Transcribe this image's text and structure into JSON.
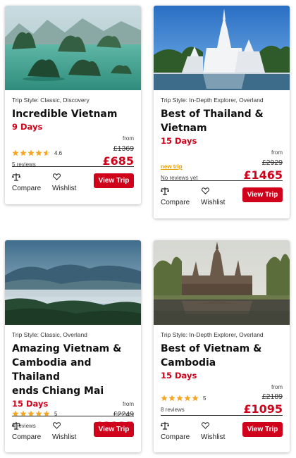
{
  "colors": {
    "accent": "#d0021b",
    "star": "#f5a623",
    "new_trip": "#e8a300"
  },
  "cards": [
    {
      "image": "halong-bay-limestone-islands",
      "trip_style": "Trip Style: Classic, Discovery",
      "title_lines": [
        "Incredible Vietnam"
      ],
      "days": "9 Days",
      "rating": 4.6,
      "rating_text": "4.6",
      "reviews": "5 reviews",
      "from": "from",
      "old_price": "£1369",
      "price": "£685",
      "compare": "Compare",
      "wishlist": "Wishlist",
      "button": "View Trip"
    },
    {
      "image": "white-temple-chiang-rai",
      "trip_style": "Trip Style: In-Depth Explorer, Overland",
      "title_lines": [
        "Best of Thailand &",
        "Vietnam"
      ],
      "days": "15 Days",
      "new_trip": "new trip",
      "reviews": "No reviews yet",
      "from": "from",
      "old_price": "£2929",
      "price": "£1465",
      "compare": "Compare",
      "wishlist": "Wishlist",
      "button": "View Trip"
    },
    {
      "image": "misty-mountain-valley",
      "trip_style": "Trip Style: Classic, Overland",
      "title_lines": [
        "Amazing Vietnam &",
        "Cambodia and Thailand",
        "ends Chiang Mai"
      ],
      "days": "15 Days",
      "rating": 5,
      "rating_text": "5",
      "reviews": "4 reviews",
      "from": "from",
      "old_price": "£2249",
      "price": "£1125",
      "compare": "Compare",
      "wishlist": "Wishlist",
      "button": "View Trip"
    },
    {
      "image": "angkor-wat-reflection",
      "trip_style": "Trip Style: In-Depth Explorer, Overland",
      "title_lines": [
        "Best of Vietnam &",
        "Cambodia"
      ],
      "days": "15 Days",
      "rating": 5,
      "rating_text": "5",
      "reviews": "8 reviews",
      "from": "from",
      "old_price": "£2189",
      "price": "£1095",
      "compare": "Compare",
      "wishlist": "Wishlist",
      "button": "View Trip"
    }
  ]
}
